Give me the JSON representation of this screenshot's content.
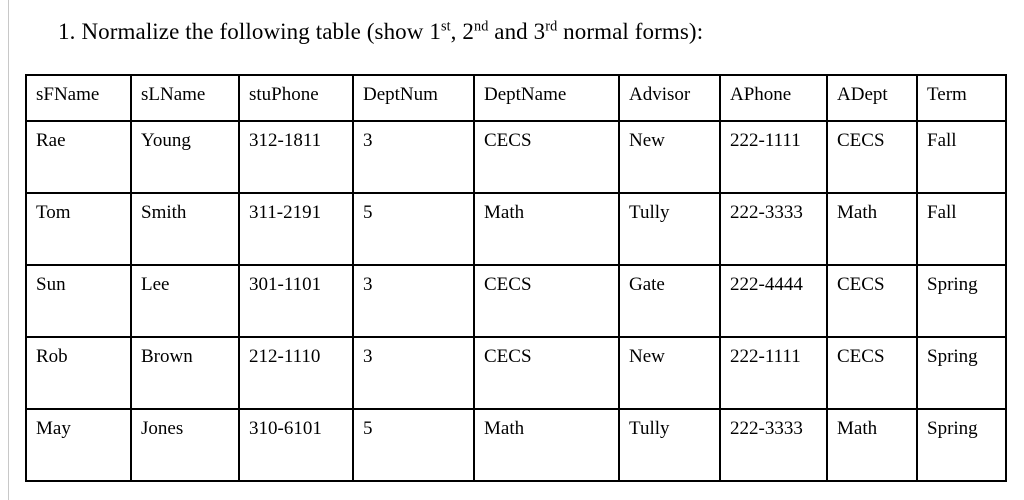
{
  "document": {
    "question": {
      "number": "1.",
      "text_before_first": "Normalize the following table (show ",
      "ordinal_1": "1",
      "ordinal_1_suffix": "st",
      "separator_1": ", ",
      "ordinal_2": "2",
      "ordinal_2_suffix": "nd",
      "separator_2": " and ",
      "ordinal_3": "3",
      "ordinal_3_suffix": "rd",
      "text_after_last": " normal forms):"
    },
    "table": {
      "headers": [
        "sFName",
        "sLName",
        "stuPhone",
        "DeptNum",
        "DeptName",
        "Advisor",
        "APhone",
        "ADept",
        "Term"
      ],
      "rows": [
        [
          "Rae",
          "Young",
          "312-1811",
          "3",
          "CECS",
          "New",
          "222-1111",
          "CECS",
          "Fall"
        ],
        [
          "Tom",
          "Smith",
          "311-2191",
          "5",
          "Math",
          "Tully",
          "222-3333",
          "Math",
          "Fall"
        ],
        [
          "Sun",
          "Lee",
          "301-1101",
          "3",
          "CECS",
          "Gate",
          "222-4444",
          "CECS",
          "Spring"
        ],
        [
          "Rob",
          "Brown",
          "212-1110",
          "3",
          "CECS",
          "New",
          "222-1111",
          "CECS",
          "Spring"
        ],
        [
          "May",
          "Jones",
          "310-6101",
          "5",
          "Math",
          "Tully",
          "222-3333",
          "Math",
          "Spring"
        ]
      ]
    }
  }
}
